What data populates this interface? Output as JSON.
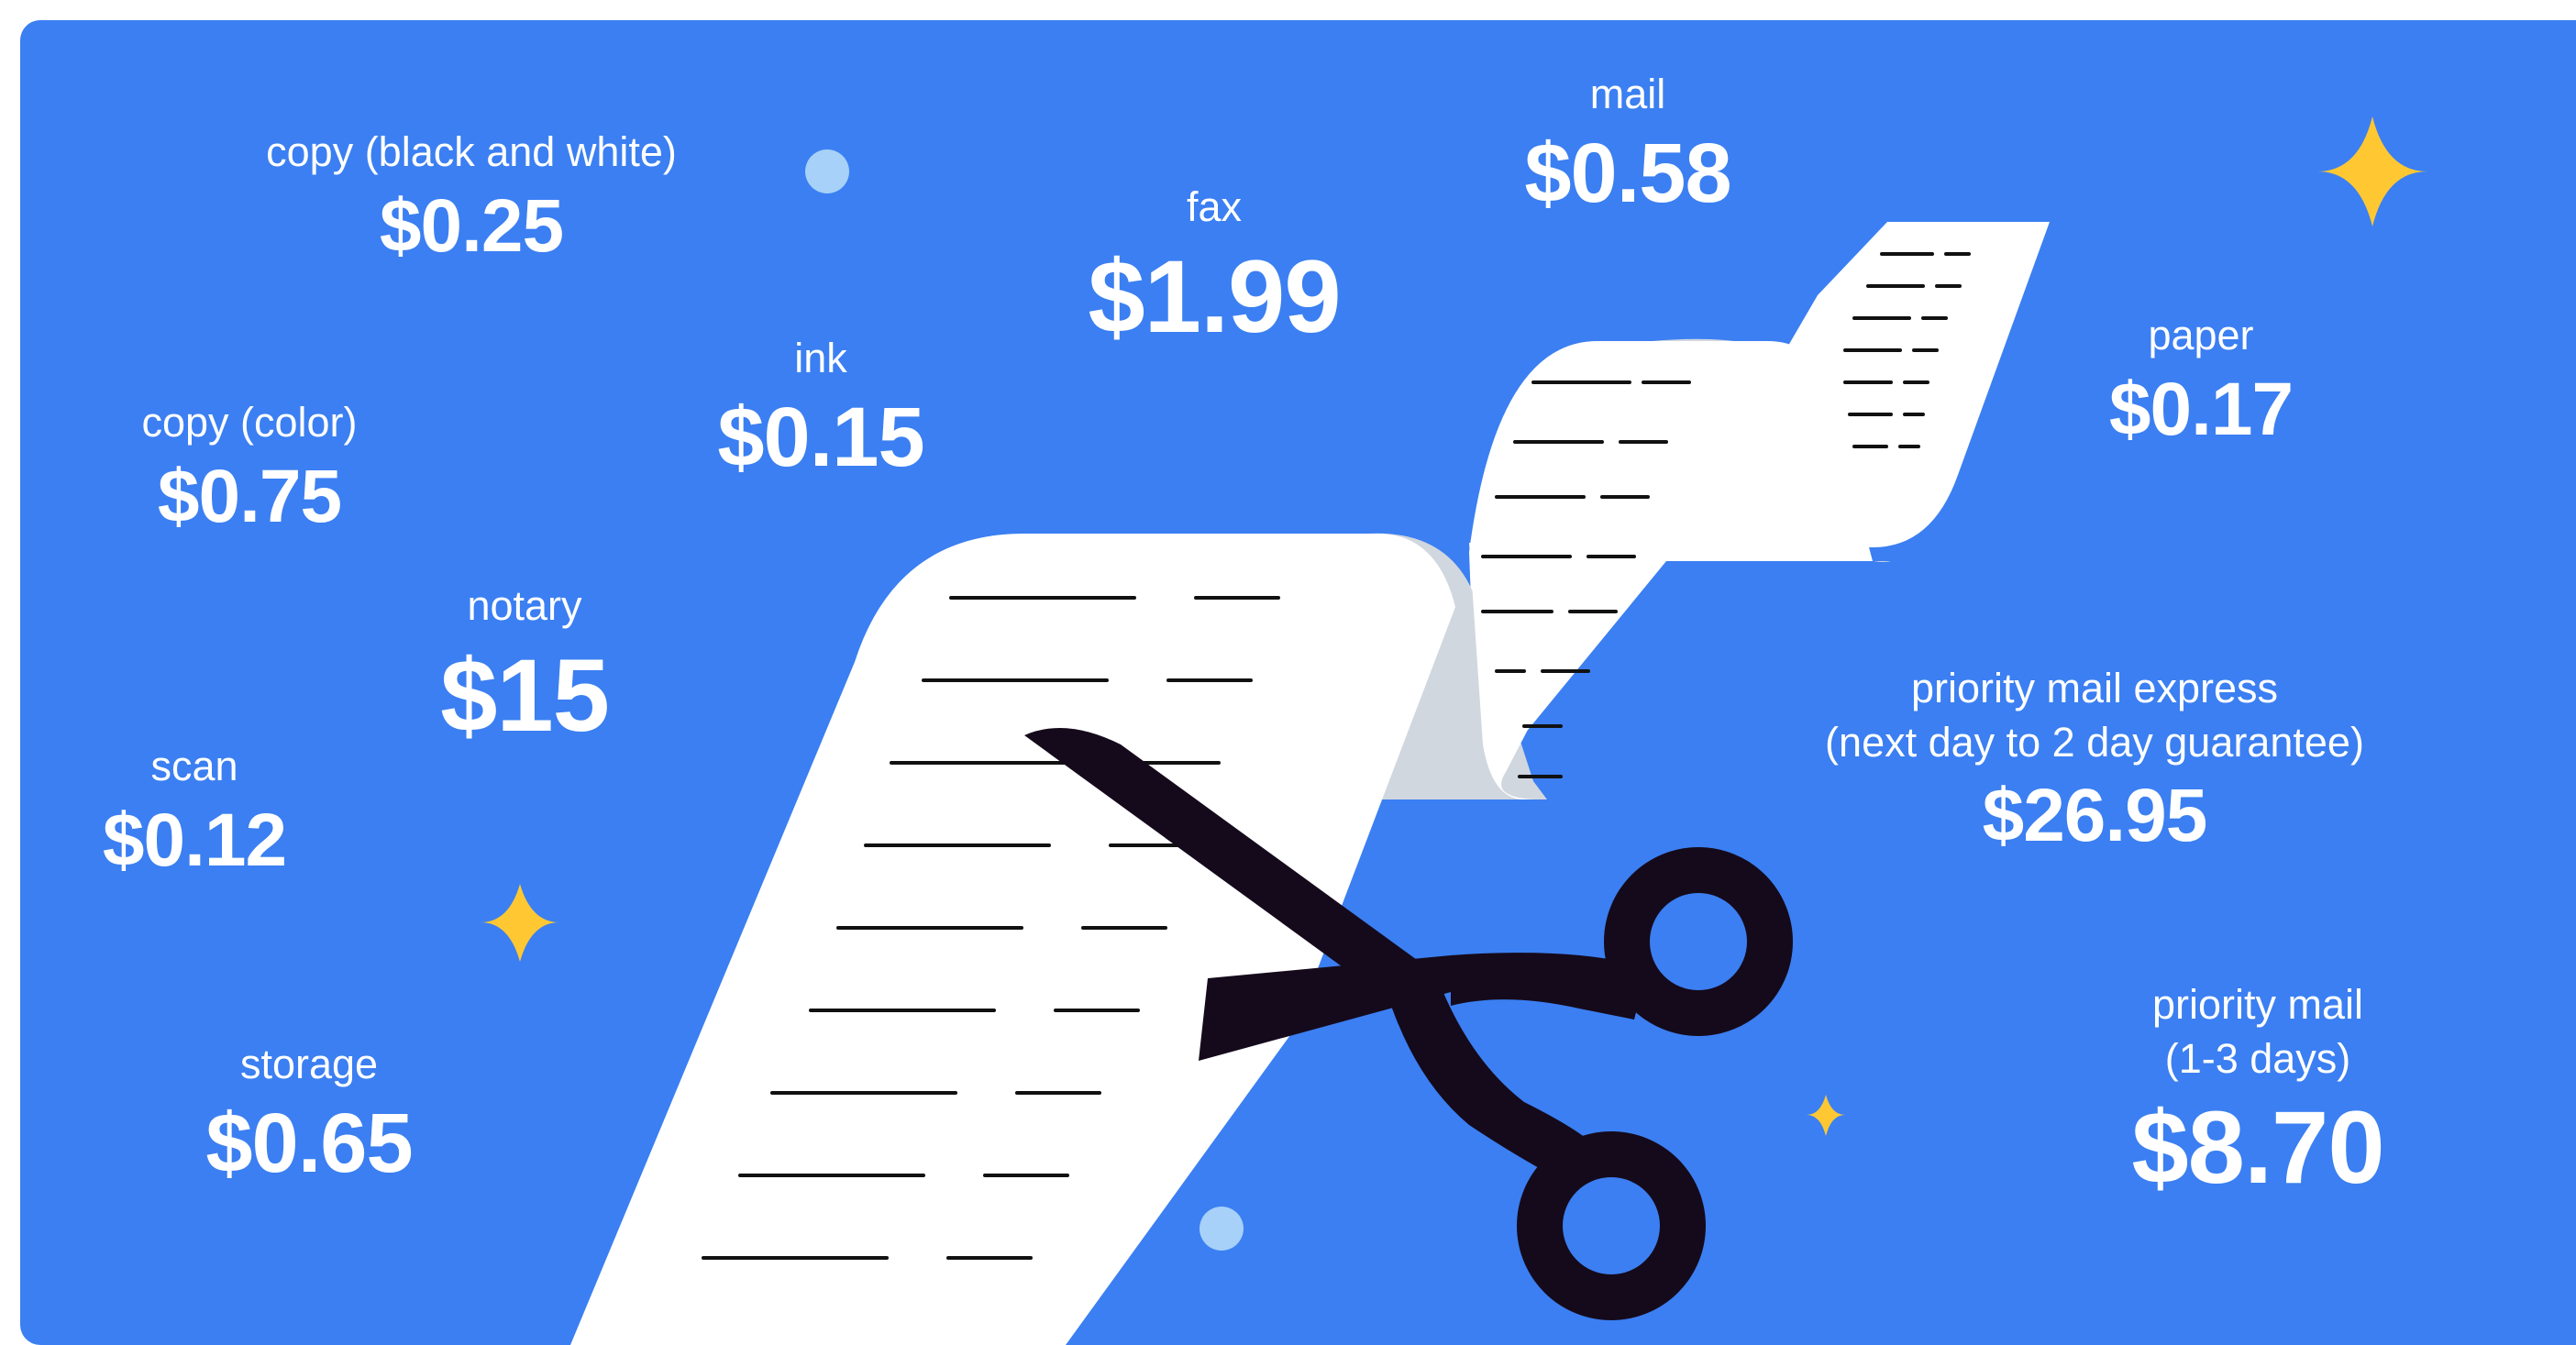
{
  "colors": {
    "background": "#3b7ff2",
    "text": "#ffffff",
    "paper": "#ffffff",
    "paper_shadow": "#d1d7df",
    "paper_lines": "#111111",
    "scissors": "#150a1b",
    "sparkle": "#ffc833",
    "dot": "#a7d1f8"
  },
  "icons": [
    "receipt-illustration",
    "scissors-icon",
    "sparkle-icon",
    "dot-decoration"
  ],
  "prices": {
    "copy_bw": {
      "label": "copy (black and white)",
      "value": "$0.25"
    },
    "copy_color": {
      "label": "copy (color)",
      "value": "$0.75"
    },
    "ink": {
      "label": "ink",
      "value": "$0.15"
    },
    "fax": {
      "label": "fax",
      "value": "$1.99"
    },
    "mail": {
      "label": "mail",
      "value": "$0.58"
    },
    "paper": {
      "label": "paper",
      "value": "$0.17"
    },
    "notary": {
      "label": "notary",
      "value": "$15"
    },
    "scan": {
      "label": "scan",
      "value": "$0.12"
    },
    "storage": {
      "label": "storage",
      "value": "$0.65"
    },
    "priority_mail_express": {
      "label_line1": "priority mail express",
      "label_line2": "(next day to 2 day guarantee)",
      "value": "$26.95"
    },
    "priority_mail": {
      "label_line1": "priority mail",
      "label_line2": "(1-3 days)",
      "value": "$8.70"
    }
  }
}
